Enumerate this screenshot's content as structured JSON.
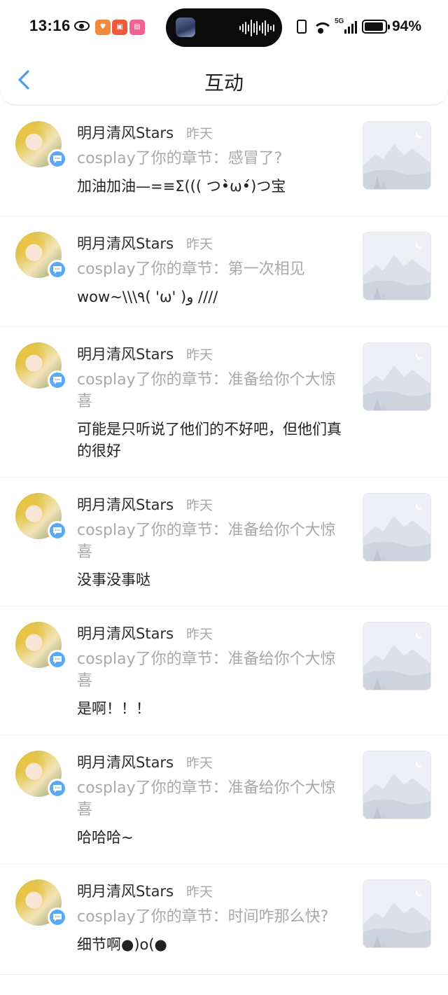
{
  "status_bar": {
    "time": "13:16",
    "battery_percent": "94%",
    "battery_level": 0.94,
    "network": "5G",
    "app_icon_labels": [
      "",
      "",
      ""
    ]
  },
  "nav": {
    "title": "互动",
    "back_icon": "chevron-left-icon",
    "accent_color": "#4a9df0"
  },
  "items": [
    {
      "name": "明月清风Stars",
      "time": "昨天",
      "context": "cosplay了你的章节：感冒了?",
      "reply": "加油加油—=≡Σ((( つ•̀ω•́)つ宝"
    },
    {
      "name": "明月清风Stars",
      "time": "昨天",
      "context": "cosplay了你的章节：第一次相见",
      "reply": "wow~\\\\\\٩( 'ω' )و ////"
    },
    {
      "name": "明月清风Stars",
      "time": "昨天",
      "context": "cosplay了你的章节：准备给你个大惊喜",
      "reply": "可能是只听说了他们的不好吧，但他们真的很好"
    },
    {
      "name": "明月清风Stars",
      "time": "昨天",
      "context": "cosplay了你的章节：准备给你个大惊喜",
      "reply": "没事没事哒"
    },
    {
      "name": "明月清风Stars",
      "time": "昨天",
      "context": "cosplay了你的章节：准备给你个大惊喜",
      "reply": "是啊！！！"
    },
    {
      "name": "明月清风Stars",
      "time": "昨天",
      "context": "cosplay了你的章节：准备给你个大惊喜",
      "reply": "哈哈哈~"
    },
    {
      "name": "明月清风Stars",
      "time": "昨天",
      "context": "cosplay了你的章节：时间咋那么快?",
      "reply": "细节啊●)o(●"
    }
  ],
  "icons": {
    "badge": "comment-bubble-icon",
    "thumbnail": "image-placeholder-icon"
  }
}
